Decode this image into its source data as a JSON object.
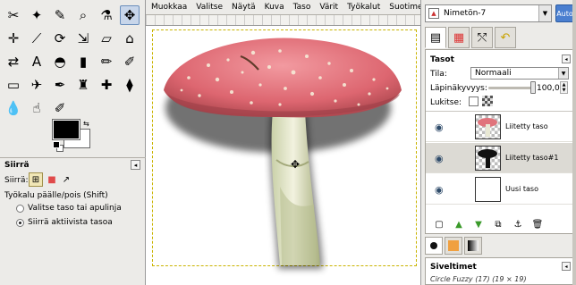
{
  "toolbox": {
    "tools": [
      {
        "name": "scissors-select-icon",
        "glyph": "✂"
      },
      {
        "name": "fuzzy-select-icon",
        "glyph": "✦"
      },
      {
        "name": "color-picker-icon",
        "glyph": "✎"
      },
      {
        "name": "zoom-icon",
        "glyph": "⌕"
      },
      {
        "name": "measure-icon",
        "glyph": "⚗"
      },
      {
        "name": "move-tool-icon",
        "glyph": "✥"
      },
      {
        "name": "align-tool-icon",
        "glyph": "✛"
      },
      {
        "name": "crop-icon",
        "glyph": "⟋"
      },
      {
        "name": "rotate-icon",
        "glyph": "⟳"
      },
      {
        "name": "scale-icon",
        "glyph": "⇲"
      },
      {
        "name": "shear-icon",
        "glyph": "▱"
      },
      {
        "name": "perspective-icon",
        "glyph": "⌂"
      },
      {
        "name": "flip-icon",
        "glyph": "⇄"
      },
      {
        "name": "text-tool-icon",
        "glyph": "A"
      },
      {
        "name": "bucket-fill-icon",
        "glyph": "◓"
      },
      {
        "name": "blend-icon",
        "glyph": "▮"
      },
      {
        "name": "pencil-icon",
        "glyph": "✏"
      },
      {
        "name": "paintbrush-icon",
        "glyph": "✐"
      },
      {
        "name": "eraser-icon",
        "glyph": "▭"
      },
      {
        "name": "airbrush-icon",
        "glyph": "✈"
      },
      {
        "name": "ink-icon",
        "glyph": "✒"
      },
      {
        "name": "clone-icon",
        "glyph": "♜"
      },
      {
        "name": "heal-icon",
        "glyph": "✚"
      },
      {
        "name": "perspective-clone-icon",
        "glyph": "⧫"
      },
      {
        "name": "blur-icon",
        "glyph": "💧"
      },
      {
        "name": "smudge-icon",
        "glyph": "☝"
      },
      {
        "name": "dodge-burn-icon",
        "glyph": "✐"
      }
    ],
    "active_tool": "move-tool-icon",
    "fg_color": "#000000",
    "bg_color": "#ffffff"
  },
  "tool_options": {
    "title": "Siirrä",
    "move_label": "Siirrä:",
    "toggle_label": "Työkalu päälle/pois  (Shift)",
    "radio_options": [
      {
        "label": "Valitse taso tai apulinja",
        "checked": false
      },
      {
        "label": "Siirrä aktiivista tasoa",
        "checked": true
      }
    ]
  },
  "image_window": {
    "menu": [
      "Muokkaa",
      "Valitse",
      "Näytä",
      "Kuva",
      "Taso",
      "Värit",
      "Työkalut",
      "Suotimet"
    ],
    "canvas_bg": "#ffffff"
  },
  "layers_dock": {
    "image_name": "Nimetön-7",
    "auto_label": "Auto",
    "panel_title": "Tasot",
    "mode_label": "Tila:",
    "mode_value": "Normaali",
    "opacity_label": "Läpinäkyvyys:",
    "opacity_value": "100,0",
    "lock_label": "Lukitse:",
    "layers": [
      {
        "name": "Liitetty taso",
        "visible": true,
        "selected": false,
        "thumb": "checker"
      },
      {
        "name": "Liitetty taso#1",
        "visible": true,
        "selected": true,
        "thumb": "checker"
      },
      {
        "name": "Uusi taso",
        "visible": true,
        "selected": false,
        "thumb": "white"
      }
    ],
    "brushes_title": "Siveltimet",
    "brush_name": "Circle Fuzzy (17) (19 × 19)"
  }
}
